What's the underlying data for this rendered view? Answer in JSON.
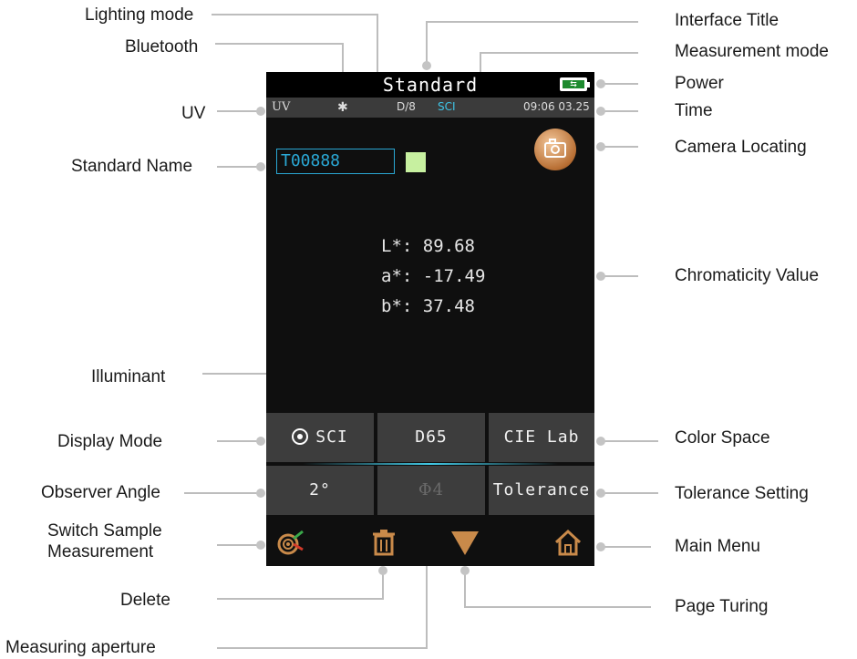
{
  "callouts": {
    "lighting_mode": "Lighting mode",
    "bluetooth": "Bluetooth",
    "interface_title": "Interface Title",
    "measurement_mode": "Measurement mode",
    "power": "Power",
    "uv": "UV",
    "time": "Time",
    "camera_locating": "Camera Locating",
    "standard_name": "Standard Name",
    "chromaticity_value": "Chromaticity Value",
    "illuminant": "Illuminant",
    "display_mode": "Display Mode",
    "color_space": "Color Space",
    "observer_angle": "Observer Angle",
    "tolerance_setting": "Tolerance Setting",
    "switch_sample_1": "Switch Sample",
    "switch_sample_2": "Measurement",
    "main_menu": "Main Menu",
    "delete": "Delete",
    "page_turing": "Page Turing",
    "measuring_aperture": "Measuring aperture"
  },
  "screen": {
    "title": "Standard",
    "status": {
      "uv": "UV",
      "bluetooth": "✱",
      "lighting": "D/8",
      "mode": "SCI",
      "time": "09:06 03.25"
    },
    "standard_name": "T00888",
    "swatch_color": "#c7f0a0",
    "values": {
      "L": "L*: 89.68",
      "a": "a*: -17.49",
      "b": "b*: 37.48"
    },
    "grid": {
      "display_mode": "SCI",
      "illuminant": "D65",
      "color_space": "CIE Lab",
      "observer": "2°",
      "aperture": "Φ4",
      "tolerance": "Tolerance"
    }
  },
  "icons": {
    "camera": "camera-icon",
    "battery": "battery-charging-icon",
    "switch_sample": "target-icon",
    "delete": "trash-icon",
    "page": "triangle-down-icon",
    "home": "home-icon"
  },
  "colors": {
    "accent": "#2aa7d4",
    "measurement_mode": "#3fc6e8",
    "page_turn": "#c98a4a",
    "trash": "#c98a4a"
  }
}
